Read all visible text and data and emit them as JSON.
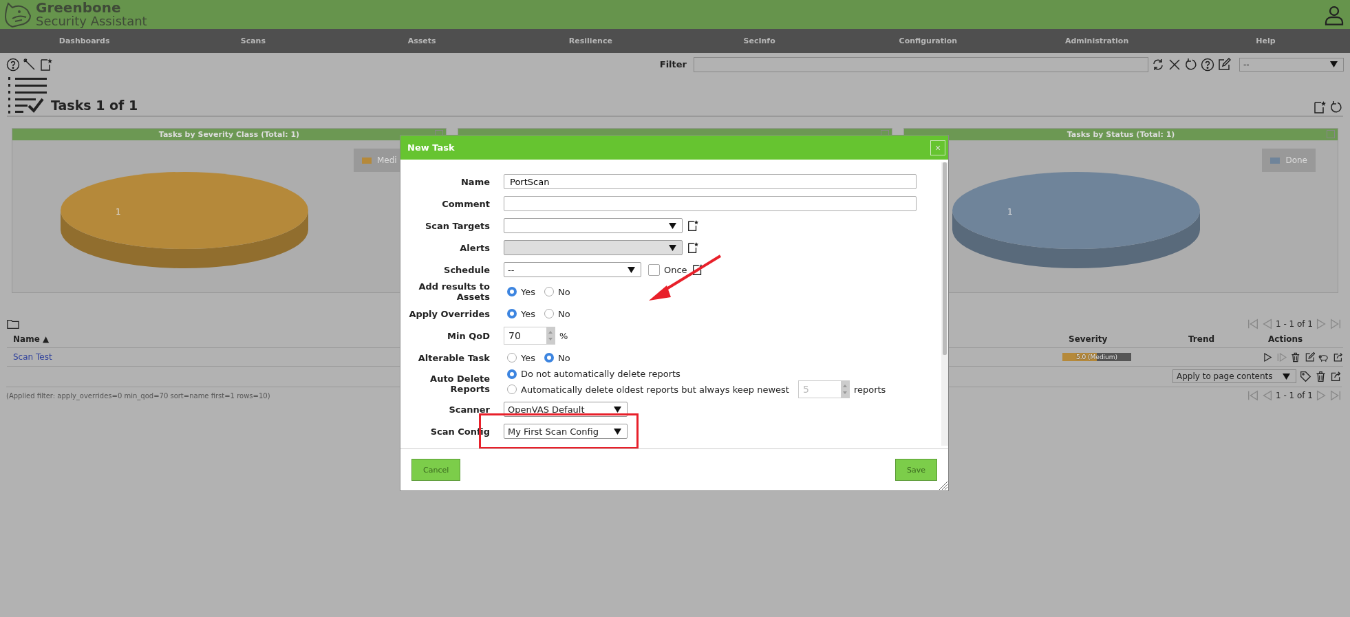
{
  "header": {
    "brand": "Greenbone",
    "subtitle": "Security Assistant"
  },
  "nav": [
    "Dashboards",
    "Scans",
    "Assets",
    "Resilience",
    "SecInfo",
    "Configuration",
    "Administration",
    "Help"
  ],
  "filter": {
    "label": "Filter",
    "preset": "--"
  },
  "page_title": "Tasks 1 of 1",
  "dashboard": [
    {
      "title": "Tasks by Severity Class (Total: 1)",
      "chart_data": {
        "type": "pie",
        "categories": [
          "Medi"
        ],
        "series": [
          {
            "color": "#b5893a",
            "values": [
              1
            ]
          }
        ],
        "data_labels": true
      }
    },
    {
      "title": "Tasks by Status (Total: 1)",
      "chart_data": {
        "type": "pie",
        "categories": [
          "Done"
        ],
        "series": [
          {
            "color": "#6f849a",
            "values": [
              1
            ]
          }
        ],
        "data_labels": true
      }
    }
  ],
  "table": {
    "columns": [
      {
        "label": "Name",
        "sort": "▲"
      },
      {
        "label": "Severity"
      },
      {
        "label": "Trend"
      },
      {
        "label": "Actions"
      }
    ],
    "rows": [
      {
        "name": "Scan Test",
        "severity": "5.0 (Medium)",
        "level": 0.5
      }
    ],
    "bulk_action": "Apply to page contents",
    "applied_filter": "(Applied filter: apply_overrides=0 min_qod=70 sort=name first=1 rows=10)",
    "pagination": [
      "1 - 1 of 1",
      "1 - 1 of 1"
    ]
  },
  "dialog": {
    "title": "New Task",
    "close": "×",
    "fields": [
      {
        "kind": "text",
        "label": "Name",
        "value": "PortScan"
      },
      {
        "kind": "text",
        "label": "Comment"
      },
      {
        "kind": "select",
        "label": "Scan Targets",
        "disabled": false,
        "new_icon": true
      },
      {
        "kind": "select",
        "label": "Alerts",
        "disabled": true,
        "new_icon": true
      },
      {
        "kind": "schedule",
        "label": "Schedule",
        "value": "--",
        "checkbox": {
          "label": "Once",
          "checked": false
        }
      },
      {
        "kind": "radio",
        "label": "Add results to Assets",
        "options": [
          {
            "label": "Yes",
            "selected": true
          },
          {
            "label": "No",
            "selected": false
          }
        ]
      },
      {
        "kind": "radio",
        "label": "Apply Overrides",
        "options": [
          {
            "label": "Yes",
            "selected": true
          },
          {
            "label": "No",
            "selected": false
          }
        ]
      },
      {
        "kind": "spin",
        "label": "Min QoD",
        "value": "70",
        "unit": "%"
      },
      {
        "kind": "radio",
        "label": "Alterable Task",
        "options": [
          {
            "label": "Yes",
            "selected": false
          },
          {
            "label": "No",
            "selected": true
          }
        ]
      },
      {
        "kind": "autodelete",
        "label": "Auto Delete Reports",
        "options": [
          {
            "label": "Do not automatically delete reports",
            "selected": true
          },
          {
            "label": "Automatically delete oldest reports but always keep newest",
            "selected": false,
            "count": "5",
            "unit": "reports"
          }
        ]
      },
      {
        "kind": "select",
        "label": "Scanner",
        "value": "OpenVAS Default",
        "disabled": false,
        "new_icon": false
      },
      {
        "kind": "select",
        "label": "Scan Config",
        "value": "My First Scan Config",
        "disabled": false,
        "new_icon": false,
        "highlighted": true
      }
    ],
    "buttons": [
      "Cancel",
      "Save"
    ]
  }
}
